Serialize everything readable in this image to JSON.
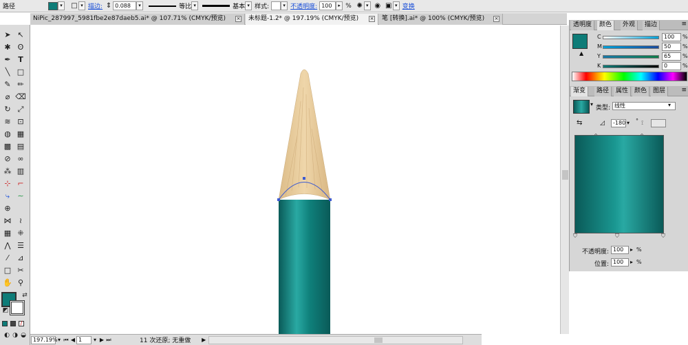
{
  "control_bar": {
    "path_label": "路径",
    "stroke_label": "描边:",
    "stroke_value": "0.088",
    "profile_label": "等比",
    "brush_label": "基本",
    "style_label": "样式:",
    "opacity_label": "不透明度:",
    "opacity_value": "100",
    "opacity_unit": "%",
    "transform_label": "变换",
    "fill_color": "#0e7c78"
  },
  "tabs": [
    {
      "label": "NiPic_287997_5981fbe2e87daeb5.ai* @ 107.71% (CMYK/预览)"
    },
    {
      "label": "未标题-1.2* @ 197.19% (CMYK/预览)"
    },
    {
      "label": "笔 [转换].ai* @ 100% (CMYK/预览)"
    }
  ],
  "status": {
    "zoom": "197.19%",
    "page": "1",
    "message": "11 次还原; 无重做"
  },
  "color_panel": {
    "tabs": [
      "透明度",
      "颜色",
      "外观",
      "描边"
    ],
    "channels": [
      {
        "name": "C",
        "value": "100",
        "unit": "%"
      },
      {
        "name": "M",
        "value": "50",
        "unit": "%"
      },
      {
        "name": "Y",
        "value": "65",
        "unit": "%"
      },
      {
        "name": "K",
        "value": "0",
        "unit": "%"
      }
    ]
  },
  "gradient_panel": {
    "tabs": [
      "渐变",
      "路径",
      "属性",
      "颜色",
      "图层"
    ],
    "type_label": "类型:",
    "type_value": "线性",
    "angle_value": "-180",
    "angle_unit": "°",
    "opacity_label": "不透明度:",
    "opacity_value": "100",
    "opacity_unit": "%",
    "location_label": "位置:",
    "location_value": "100",
    "location_unit": "%"
  },
  "colors": {
    "teal": "#0e7c78",
    "teal_dark": "#0a5a58",
    "teal_light": "#29a9a3",
    "wood": "#e9cc9c",
    "selection": "#3d5bd1"
  }
}
